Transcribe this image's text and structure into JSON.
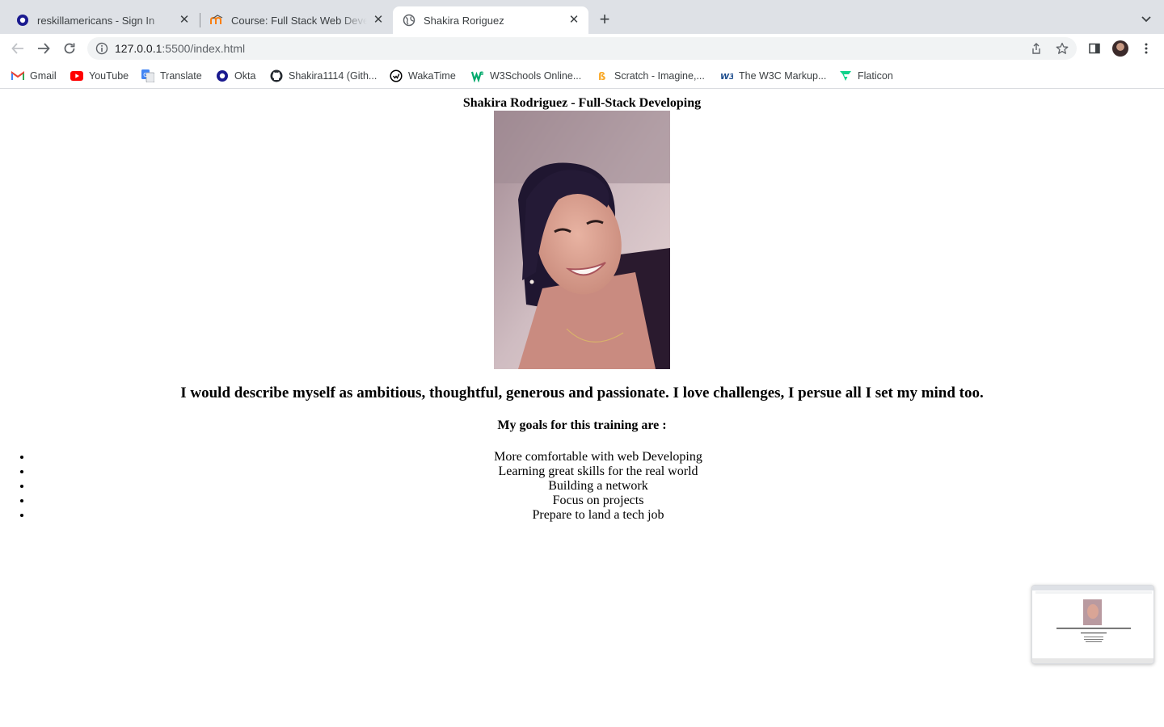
{
  "browser": {
    "tabs": [
      {
        "title": "reskillamericans - Sign In",
        "active": false
      },
      {
        "title": "Course: Full Stack Web Developing",
        "active": false
      },
      {
        "title": "Shakira Roriguez",
        "active": true
      }
    ],
    "address": {
      "host": "127.0.0.1",
      "rest": ":5500/index.html"
    },
    "bookmarks": [
      {
        "label": "Gmail",
        "icon": "gmail-icon"
      },
      {
        "label": "YouTube",
        "icon": "youtube-icon"
      },
      {
        "label": "Translate",
        "icon": "translate-icon"
      },
      {
        "label": "Okta",
        "icon": "okta-icon"
      },
      {
        "label": "Shakira1114 (Gith...",
        "icon": "github-icon"
      },
      {
        "label": "WakaTime",
        "icon": "wakatime-icon"
      },
      {
        "label": "W3Schools Online...",
        "icon": "w3schools-icon"
      },
      {
        "label": "Scratch - Imagine,...",
        "icon": "scratch-icon"
      },
      {
        "label": "The W3C Markup...",
        "icon": "w3c-icon"
      },
      {
        "label": "Flaticon",
        "icon": "flaticon-icon"
      }
    ]
  },
  "page": {
    "heading": "Shakira Rodriguez - Full-Stack Developing",
    "description": "I would describe myself as ambitious, thoughtful, generous and passionate. I love challenges, I persue all I set my mind too.",
    "goals_title": "My goals for this training are :",
    "goals": [
      "More comfortable with web Developing",
      "Learning great skills for the real world",
      "Building a network",
      "Focus on projects",
      "Prepare to land a tech job"
    ]
  },
  "colors": {
    "tabstrip": "#dee1e6",
    "omnibox": "#f1f3f4",
    "okta_blue": "#1a1a8f",
    "youtube_red": "#ff0000"
  }
}
